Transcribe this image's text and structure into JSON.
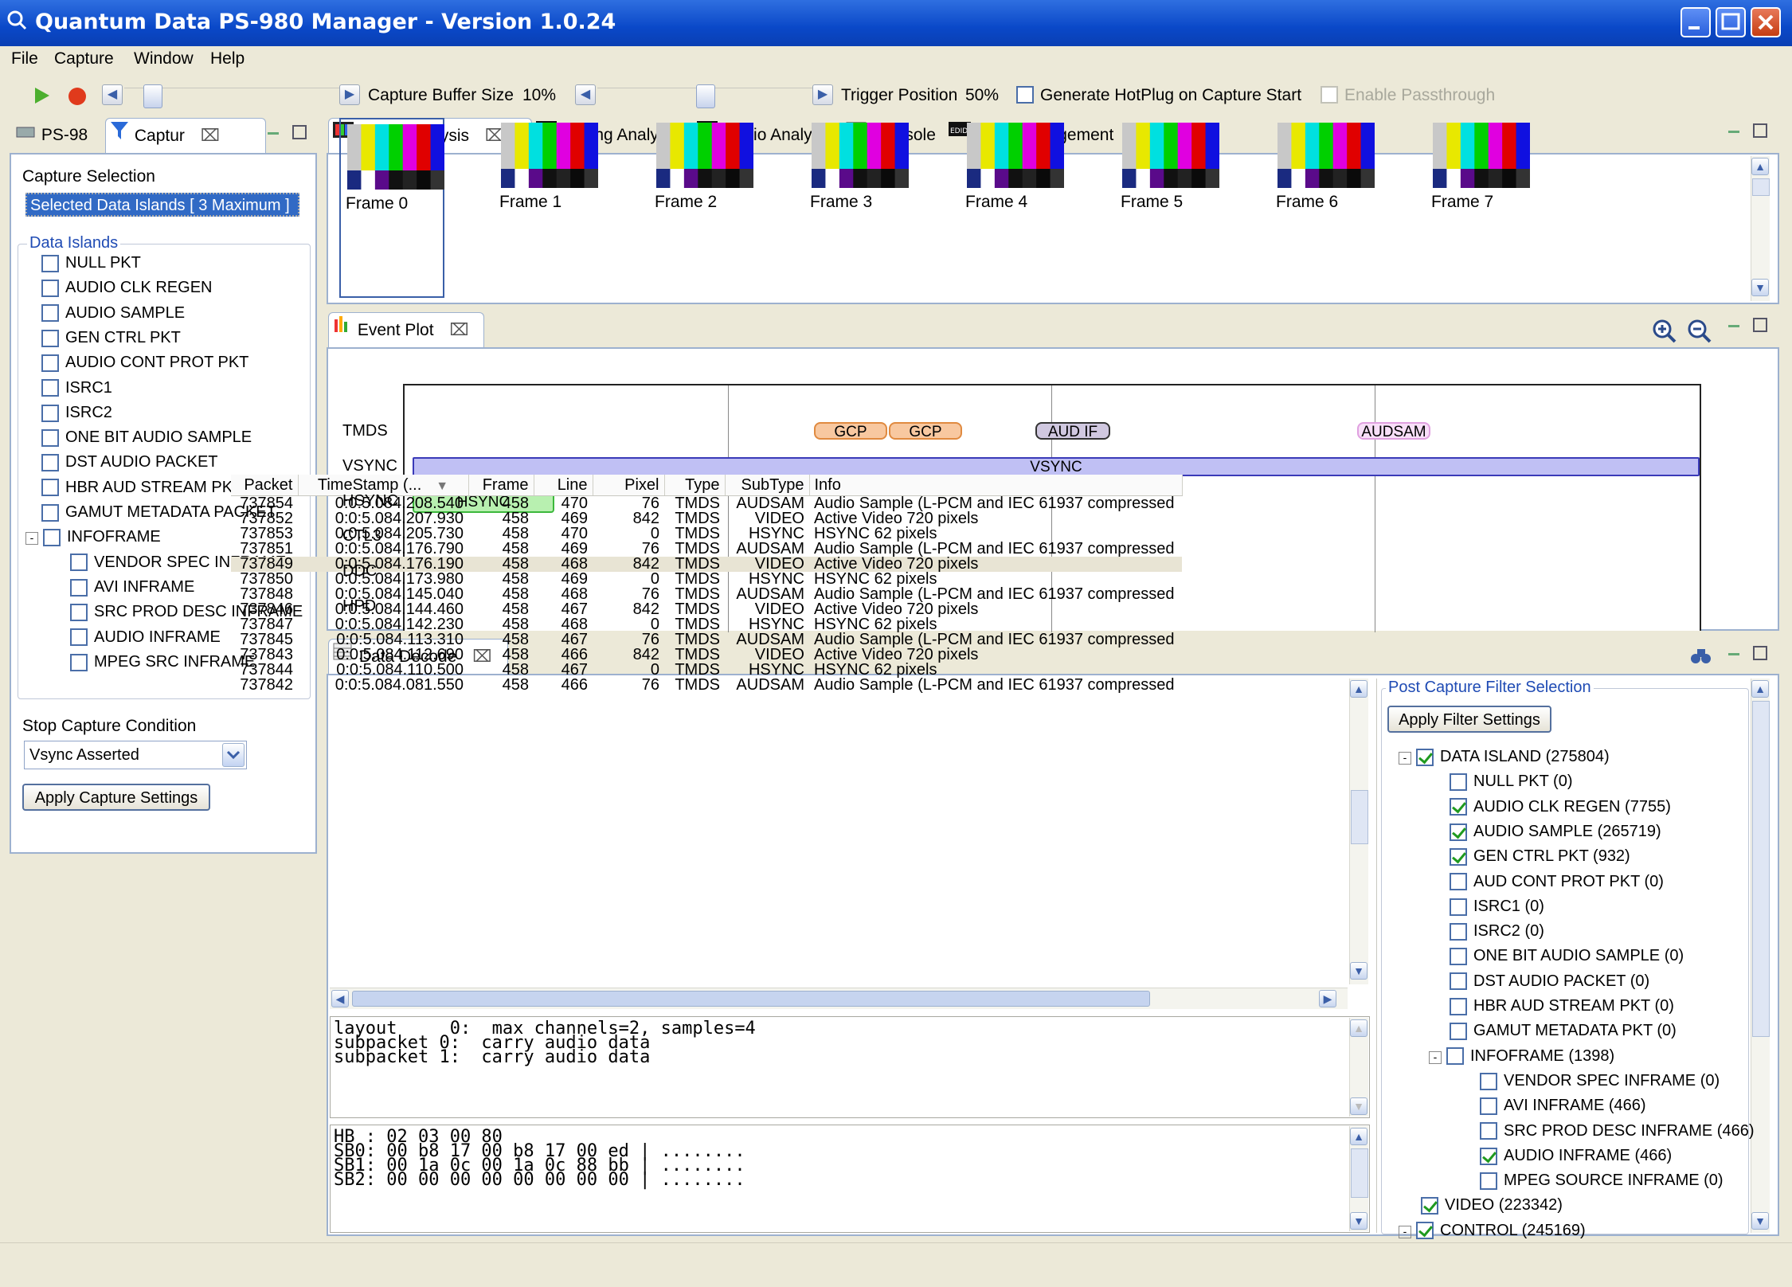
{
  "window": {
    "title": "Quantum Data PS-980 Manager - Version 1.0.24"
  },
  "menu": [
    "File",
    "Capture",
    "Window",
    "Help"
  ],
  "toolbar": {
    "buffer_label": "Capture Buffer Size",
    "buffer_value": "10%",
    "trigger_label": "Trigger Position",
    "trigger_value": "50%",
    "hotplug_label": "Generate HotPlug on Capture Start",
    "passthrough_label": "Enable Passthrough"
  },
  "left_tabs": {
    "ps98": "PS-98",
    "capture": "Captur"
  },
  "capture": {
    "selection_title": "Capture Selection",
    "selected_islands": "Selected Data Islands [ 3 Maximum ]",
    "islands_group": "Data Islands",
    "islands": [
      "NULL PKT",
      "AUDIO CLK REGEN",
      "AUDIO SAMPLE",
      "GEN CTRL PKT",
      "AUDIO CONT PROT PKT",
      "ISRC1",
      "ISRC2",
      "ONE BIT AUDIO SAMPLE",
      "DST AUDIO PACKET",
      "HBR AUD STREAM PKT",
      "GAMUT METADATA PACKET",
      "INFOFRAME"
    ],
    "infoframes": [
      "VENDOR SPEC INFRAME",
      "AVI INFRAME",
      "SRC PROD DESC INFRAME",
      "AUDIO INFRAME",
      "MPEG SRC INFRAME"
    ],
    "stop_title": "Stop Capture Condition",
    "stop_value": "Vsync Asserted",
    "apply_button": "Apply Capture Settings"
  },
  "main_tabs": [
    "Video Analysis",
    "Timing Analyzer",
    "Audio Analysis",
    "Console",
    "Edid Management"
  ],
  "frames": [
    "Frame 0",
    "Frame 1",
    "Frame 2",
    "Frame 3",
    "Frame 4",
    "Frame 5",
    "Frame 6",
    "Frame 7"
  ],
  "colors": {
    "bars": [
      "#c8c8c8",
      "#e8e800",
      "#00e0e0",
      "#00d000",
      "#e000e0",
      "#e00000",
      "#1010e0"
    ]
  },
  "event_plot": {
    "tab": "Event Plot",
    "rows": [
      "TMDS",
      "VSYNC",
      "HSYNC",
      "CTL3",
      "DDC",
      "HPD"
    ],
    "events": {
      "gcp1": "GCP",
      "gcp2": "GCP",
      "audif": "AUD IF",
      "audsam": "AUDSAM",
      "vsync": "VSYNC",
      "hsync": "HSYNC"
    }
  },
  "data_decode": {
    "tab": "Data Decode",
    "columns": [
      "Packet",
      "TimeStamp (...",
      "Frame",
      "Line",
      "Pixel",
      "Type",
      "SubType",
      "Info"
    ],
    "rows": [
      [
        "737854",
        "0:0:5.084.208.540",
        "458",
        "470",
        "76",
        "TMDS",
        "AUDSAM",
        "Audio Sample (L-PCM and IEC 61937 compressed"
      ],
      [
        "737852",
        "0:0:5.084.207.930",
        "458",
        "469",
        "842",
        "TMDS",
        "VIDEO",
        "Active Video 720 pixels"
      ],
      [
        "737853",
        "0:0:5.084.205.730",
        "458",
        "470",
        "0",
        "TMDS",
        "HSYNC",
        "HSYNC 62 pixels"
      ],
      [
        "737851",
        "0:0:5.084.176.790",
        "458",
        "469",
        "76",
        "TMDS",
        "AUDSAM",
        "Audio Sample (L-PCM and IEC 61937 compressed"
      ],
      [
        "737849",
        "0:0:5.084.176.190",
        "458",
        "468",
        "842",
        "TMDS",
        "VIDEO",
        "Active Video 720 pixels"
      ],
      [
        "737850",
        "0:0:5.084.173.980",
        "458",
        "469",
        "0",
        "TMDS",
        "HSYNC",
        "HSYNC 62 pixels"
      ],
      [
        "737848",
        "0:0:5.084.145.040",
        "458",
        "468",
        "76",
        "TMDS",
        "AUDSAM",
        "Audio Sample (L-PCM and IEC 61937 compressed"
      ],
      [
        "737846",
        "0:0:5.084.144.460",
        "458",
        "467",
        "842",
        "TMDS",
        "VIDEO",
        "Active Video 720 pixels"
      ],
      [
        "737847",
        "0:0:5.084.142.230",
        "458",
        "468",
        "0",
        "TMDS",
        "HSYNC",
        "HSYNC 62 pixels"
      ],
      [
        "737845",
        "0:0:5.084.113.310",
        "458",
        "467",
        "76",
        "TMDS",
        "AUDSAM",
        "Audio Sample (L-PCM and IEC 61937 compressed"
      ],
      [
        "737843",
        "0:0:5.084.112.690",
        "458",
        "466",
        "842",
        "TMDS",
        "VIDEO",
        "Active Video 720 pixels"
      ],
      [
        "737844",
        "0:0:5.084.110.500",
        "458",
        "467",
        "0",
        "TMDS",
        "HSYNC",
        "HSYNC 62 pixels"
      ],
      [
        "737842",
        "0:0:5.084.081.550",
        "458",
        "466",
        "76",
        "TMDS",
        "AUDSAM",
        "Audio Sample (L-PCM and IEC 61937 compressed"
      ]
    ],
    "detail1": "layout     0:  max channels=2, samples=4\nsubpacket 0:  carry audio data\nsubpacket 1:  carry audio data",
    "detail2": "HB : 02 03 00 80\nSB0: 00 b8 17 00 b8 17 00 ed | ........\nSB1: 00 1a 0c 00 1a 0c 88 bb | ........\nSB2: 00 00 00 00 00 00 00 00 | ........"
  },
  "filter": {
    "title": "Post Capture Filter Selection",
    "apply_button": "Apply Filter Settings",
    "data_island": "DATA ISLAND (275804)",
    "items": [
      {
        "label": "NULL PKT (0)",
        "checked": false
      },
      {
        "label": "AUDIO CLK REGEN (7755)",
        "checked": true
      },
      {
        "label": "AUDIO SAMPLE (265719)",
        "checked": true
      },
      {
        "label": "GEN CTRL PKT (932)",
        "checked": true
      },
      {
        "label": "AUD CONT PROT PKT (0)",
        "checked": false
      },
      {
        "label": "ISRC1 (0)",
        "checked": false
      },
      {
        "label": "ISRC2 (0)",
        "checked": false
      },
      {
        "label": "ONE BIT AUDIO SAMPLE (0)",
        "checked": false
      },
      {
        "label": "DST AUDIO PACKET (0)",
        "checked": false
      },
      {
        "label": "HBR AUD STREAM PKT (0)",
        "checked": false
      },
      {
        "label": "GAMUT METADATA PKT (0)",
        "checked": false
      },
      {
        "label": "INFOFRAME (1398)",
        "checked": false
      }
    ],
    "infoframes": [
      {
        "label": "VENDOR SPEC INFRAME (0)",
        "checked": false
      },
      {
        "label": "AVI INFRAME (466)",
        "checked": false
      },
      {
        "label": "SRC PROD DESC INFRAME (466)",
        "checked": false
      },
      {
        "label": "AUDIO INFRAME (466)",
        "checked": true
      },
      {
        "label": "MPEG SOURCE INFRAME (0)",
        "checked": false
      }
    ],
    "video": "VIDEO (223342)",
    "control": "CONTROL (245169)"
  }
}
